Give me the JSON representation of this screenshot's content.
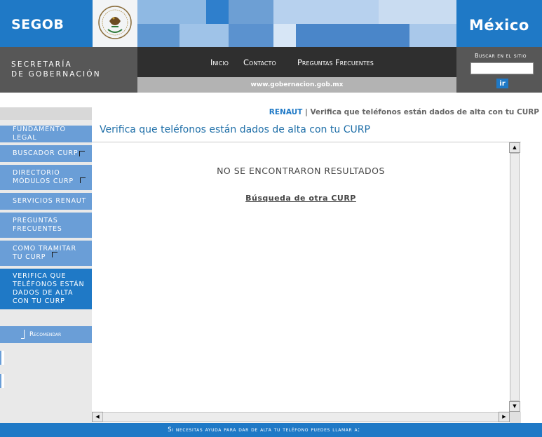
{
  "header": {
    "segob_logo": "SEGOB",
    "mexico_logo": "México",
    "secretaria_line1": "SECRETARÍA",
    "secretaria_line2": "DE GOBERNACIÓN",
    "seal_alt": "escudo nacional",
    "nav": [
      {
        "label": "Inicio"
      },
      {
        "label": "Contacto"
      },
      {
        "label": "Preguntas Frecuentes"
      }
    ],
    "url": "www.gobernacion.gob.mx",
    "search_label": "Buscar en el sitio",
    "search_value": "",
    "search_button": "ir"
  },
  "sidebar": {
    "items": [
      {
        "label": "FUNDAMENTO LEGAL",
        "external": false
      },
      {
        "label": "BUSCADOR CURP",
        "external": true
      },
      {
        "label": "DIRECTORIO MÓDULOS CURP",
        "external": true
      },
      {
        "label": "SERVICIOS RENAUT",
        "external": false
      },
      {
        "label": "PREGUNTAS FRECUENTES",
        "external": false
      },
      {
        "label": "COMO TRAMITAR TU CURP",
        "external": true
      },
      {
        "label": "VERIFICA QUE TELÉFONOS ESTÁN DADOS DE ALTA CON TU CURP",
        "external": false,
        "active": true
      }
    ],
    "recommend": "Recomendar"
  },
  "breadcrumb": {
    "link": "RENAUT",
    "separator": "|",
    "current": "Verifica que teléfonos están dados de alta con tu CURP"
  },
  "page": {
    "title": "Verifica que teléfonos están dados de alta con tu CURP",
    "no_results": "NO SE ENCONTRARON RESULTADOS",
    "other_search": "Búsqueda de otra CURP"
  },
  "footer": {
    "text": "Si necesitas ayuda para dar de alta tu teléfono puedes llamar a:"
  },
  "colors": {
    "brand_blue": "#1f79c6",
    "sidebar_blue": "#6a9ed7",
    "dark_gray": "#575757"
  }
}
